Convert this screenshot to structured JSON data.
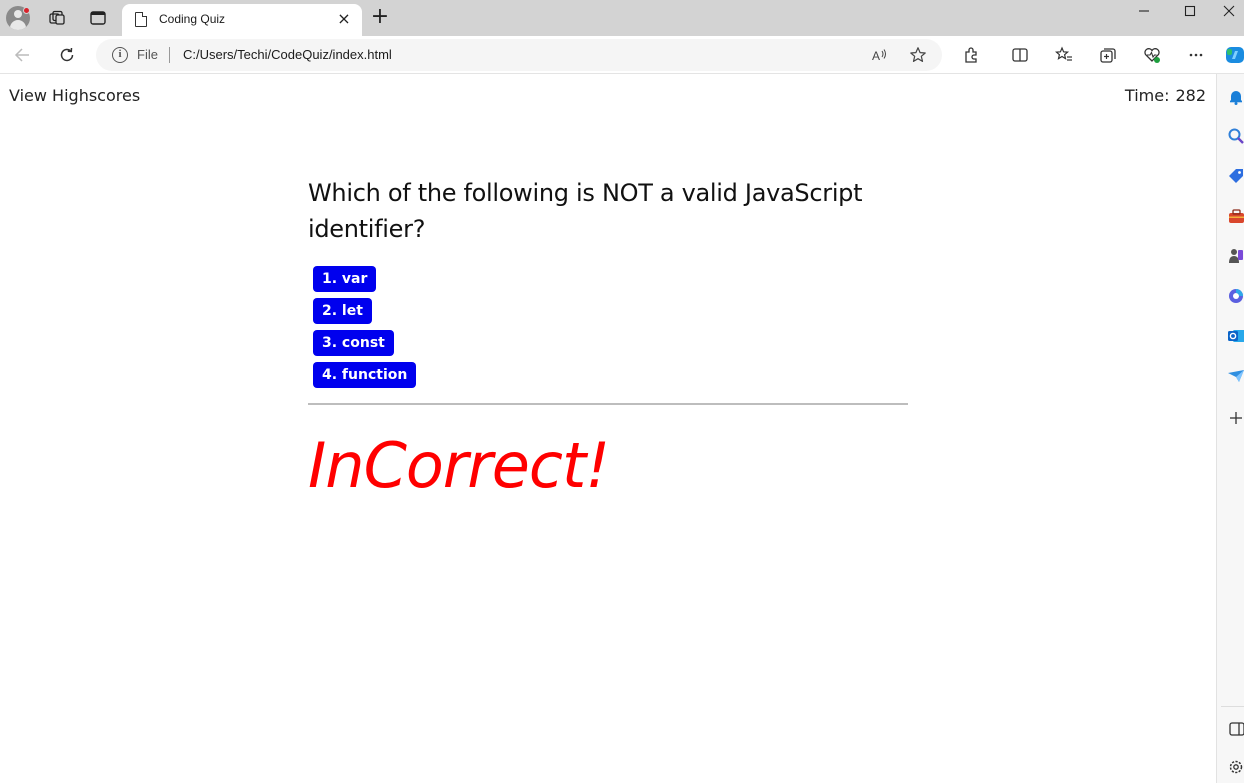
{
  "browser": {
    "tab": {
      "title": "Coding Quiz",
      "close_symbol": "×"
    },
    "new_tab_symbol": "+",
    "window_controls": {
      "minimize": "—",
      "maximize": "☐",
      "close": "✕"
    },
    "address_bar": {
      "scheme_label": "File",
      "url": "C:/Users/Techi/CodeQuiz/index.html"
    },
    "toolbar_icons": [
      "back-icon",
      "refresh-icon",
      "read-aloud-icon",
      "favorite-star-icon",
      "extensions-icon",
      "split-screen-icon",
      "favorites-icon",
      "collections-icon",
      "browser-essentials-icon",
      "more-options-icon",
      "copilot-icon"
    ],
    "sidebar_icons": [
      "notifications-icon",
      "search-icon",
      "shopping-tag-icon",
      "tools-icon",
      "games-icon",
      "microsoft-365-icon",
      "outlook-icon",
      "drop-icon",
      "add-icon",
      "hide-sidebar-icon",
      "settings-icon"
    ]
  },
  "page": {
    "header": {
      "highscores_link": "View Highscores",
      "timer_label": "Time:",
      "timer_value": "282"
    },
    "quiz": {
      "question": "Which of the following is NOT a valid JavaScript identifier?",
      "choices": [
        {
          "label": "1. var"
        },
        {
          "label": "2. let"
        },
        {
          "label": "3. const"
        },
        {
          "label": "4. function"
        }
      ],
      "feedback": "InCorrect!"
    }
  },
  "colors": {
    "choice_button": "#0000ee",
    "feedback_text": "#ff0000",
    "tabstrip": "#d3d3d3"
  }
}
